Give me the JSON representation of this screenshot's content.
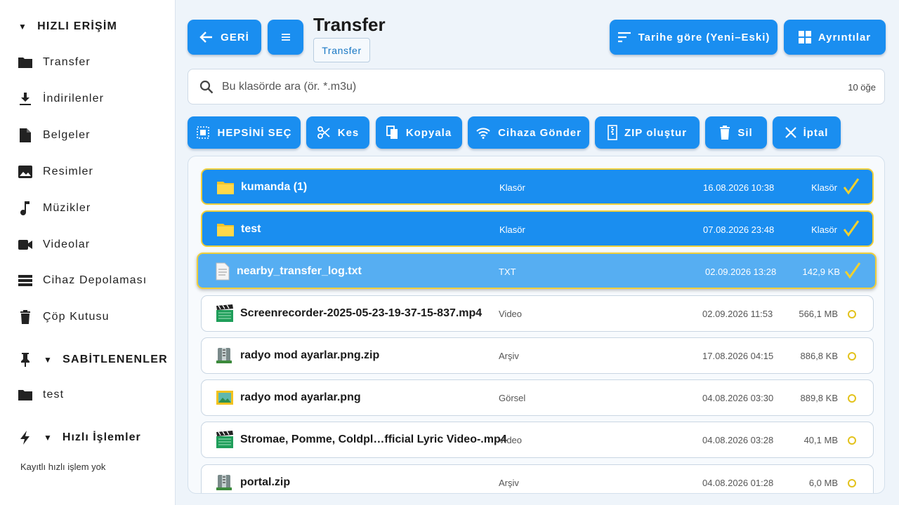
{
  "sidebar": {
    "quick_access_title": "HIZLI ERİŞİM",
    "items": [
      {
        "label": "Transfer",
        "icon": "folder-icon"
      },
      {
        "label": "İndirilenler",
        "icon": "download-icon"
      },
      {
        "label": "Belgeler",
        "icon": "document-icon"
      },
      {
        "label": "Resimler",
        "icon": "image-icon"
      },
      {
        "label": "Müzikler",
        "icon": "music-icon"
      },
      {
        "label": "Videolar",
        "icon": "video-icon"
      },
      {
        "label": "Cihaz Depolaması",
        "icon": "storage-icon"
      },
      {
        "label": "Çöp Kutusu",
        "icon": "trash-icon"
      }
    ],
    "pinned_title": "SABİTLENENLER",
    "pinned_items": [
      {
        "label": "test",
        "icon": "folder-icon"
      }
    ],
    "quick_actions_title": "Hızlı İşlemler",
    "quick_actions_empty": "Kayıtlı hızlı işlem yok"
  },
  "header": {
    "back_label": "GERİ",
    "title": "Transfer",
    "breadcrumb": "Transfer",
    "sort_label": "Tarihe göre (Yeni–Eski)",
    "view_label": "Ayrıntılar"
  },
  "search": {
    "placeholder": "Bu klasörde ara (ör. *.m3u)",
    "count": "10 öğe"
  },
  "actions": {
    "select_all": "HEPSİNİ SEÇ",
    "cut": "Kes",
    "copy": "Kopyala",
    "send": "Cihaza Gönder",
    "zip": "ZIP oluştur",
    "delete": "Sil",
    "cancel": "İptal"
  },
  "colors": {
    "accent": "#1a8ef0",
    "selection_border": "#f0cf3a",
    "highlight": "#56aef2"
  },
  "files": [
    {
      "name": "kumanda (1)",
      "type": "Klasör",
      "date": "16.08.2026 10:38",
      "size": "Klasör",
      "icon": "folder-icon",
      "state": "selected"
    },
    {
      "name": "test",
      "type": "Klasör",
      "date": "07.08.2026 23:48",
      "size": "Klasör",
      "icon": "folder-icon",
      "state": "selected"
    },
    {
      "name": "nearby_transfer_log.txt",
      "type": "TXT",
      "date": "02.09.2026 13:28",
      "size": "142,9 KB",
      "icon": "text-file-icon",
      "state": "focused"
    },
    {
      "name": "Screenrecorder-2025-05-23-19-37-15-837.mp4",
      "type": "Video",
      "date": "02.09.2026 11:53",
      "size": "566,1 MB",
      "icon": "video-file-icon",
      "state": "normal"
    },
    {
      "name": "radyo mod ayarlar.png.zip",
      "type": "Arşiv",
      "date": "17.08.2026 04:15",
      "size": "886,8 KB",
      "icon": "archive-icon",
      "state": "normal"
    },
    {
      "name": "radyo mod ayarlar.png",
      "type": "Görsel",
      "date": "04.08.2026 03:30",
      "size": "889,8 KB",
      "icon": "image-file-icon",
      "state": "normal"
    },
    {
      "name": "Stromae, Pomme, Coldpl…fficial Lyric Video-.mp4",
      "type": "Video",
      "date": "04.08.2026 03:28",
      "size": "40,1 MB",
      "icon": "video-file-icon",
      "state": "normal"
    },
    {
      "name": "portal.zip",
      "type": "Arşiv",
      "date": "04.08.2026 01:28",
      "size": "6,0 MB",
      "icon": "archive-icon",
      "state": "normal"
    }
  ]
}
